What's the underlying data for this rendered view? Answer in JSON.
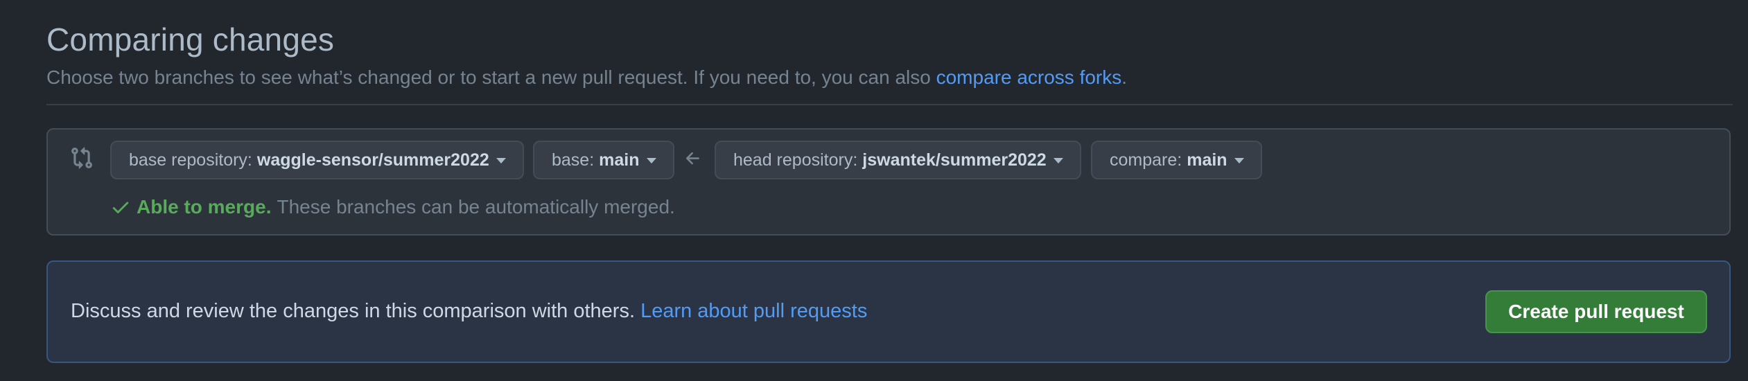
{
  "header": {
    "title": "Comparing changes",
    "subtitle_prefix": "Choose two branches to see what’s changed or to start a new pull request. If you need to, you can also ",
    "subtitle_link": "compare across forks",
    "subtitle_suffix": "."
  },
  "range": {
    "base_repository": {
      "label": "base repository:",
      "value": "waggle-sensor/summer2022"
    },
    "base": {
      "label": "base:",
      "value": "main"
    },
    "head_repository": {
      "label": "head repository:",
      "value": "jswantek/summer2022"
    },
    "compare": {
      "label": "compare:",
      "value": "main"
    }
  },
  "merge_status": {
    "status": "Able to merge.",
    "message": "These branches can be automatically merged."
  },
  "discuss": {
    "text": "Discuss and review the changes in this comparison with others. ",
    "link": "Learn about pull requests",
    "button": "Create pull request"
  },
  "colors": {
    "background": "#22272e",
    "link": "#539bf5",
    "success": "#57ab5a",
    "primary_button": "#347d39"
  },
  "icons": {
    "compare": "git-compare-icon",
    "arrow": "arrow-left-icon",
    "check": "check-icon",
    "dropdown": "triangle-down-icon"
  }
}
